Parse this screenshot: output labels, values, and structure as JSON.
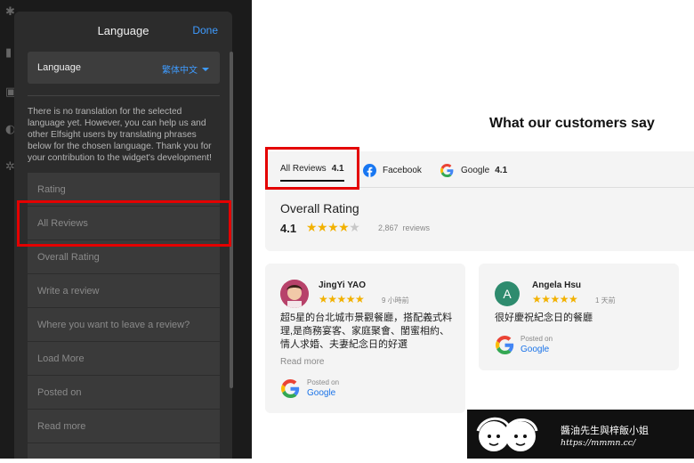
{
  "editor": {
    "title": "Language",
    "done_label": "Done",
    "language": {
      "label": "Language",
      "value": "繁体中文"
    },
    "notice": "There is no translation for the selected language yet. However, you can help us and other Elfsight users by translating phrases below for the chosen language. Thank you for your contribution to the widget's development!",
    "phrases": [
      "Rating",
      "All Reviews",
      "Overall Rating",
      "Write a review",
      "Where you want to leave a review?",
      "Load More",
      "Posted on",
      "Read more"
    ]
  },
  "widget": {
    "heading": "What our customers say",
    "tabs": [
      {
        "label": "All Reviews",
        "rating": "4.1"
      },
      {
        "label": "Facebook"
      },
      {
        "label": "Google",
        "rating": "4.1"
      }
    ],
    "overall": {
      "title": "Overall Rating",
      "score": "4.1",
      "stars": 4,
      "count": "2,867",
      "count_label": "reviews"
    },
    "reviews": [
      {
        "name": "JingYi YAO",
        "time": "9 小時前",
        "text": "超5星的台北城市景觀餐廳，搭配義式料理,是商務宴客、家庭聚會、閨蜜相約、情人求婚、夫妻紀念日的好選",
        "read_more": "Read more",
        "posted_on": "Posted on",
        "source": "Google"
      },
      {
        "name": "Angela Hsu",
        "avatar_letter": "A",
        "time": "1 天前",
        "text": "很好慶祝紀念日的餐廳",
        "posted_on": "Posted on",
        "source": "Google"
      }
    ]
  },
  "watermark": {
    "title": "醬油先生與梓飯小姐",
    "url": "https://mmmn.cc/"
  },
  "colors": {
    "accent": "#3e9bff",
    "highlight": "#e40000",
    "star": "#f2b100",
    "google_link": "#1a73e8"
  }
}
